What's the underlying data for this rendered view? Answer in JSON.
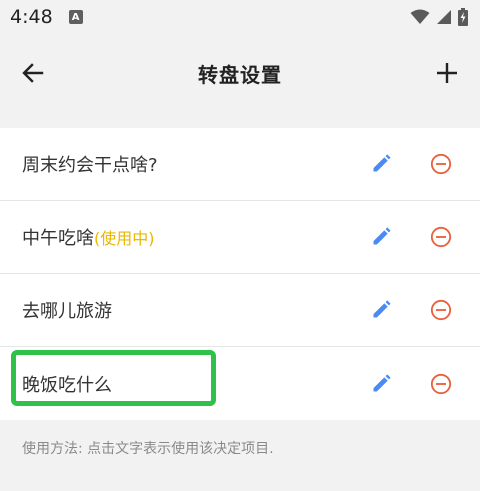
{
  "status_bar": {
    "time": "4:48",
    "notification_letter": "A"
  },
  "app_bar": {
    "title": "转盘设置"
  },
  "items": [
    {
      "label": "周末约会干点啥?",
      "tag": ""
    },
    {
      "label": "中午吃啥",
      "tag": "(使用中)"
    },
    {
      "label": "去哪儿旅游",
      "tag": ""
    },
    {
      "label": "晚饭吃什么",
      "tag": ""
    }
  ],
  "hint": "使用方法: 点击文字表示使用该决定项目.",
  "colors": {
    "edit": "#4a8af4",
    "delete": "#e8613c",
    "in_use": "#e8b800",
    "highlight": "#2fc24a"
  }
}
